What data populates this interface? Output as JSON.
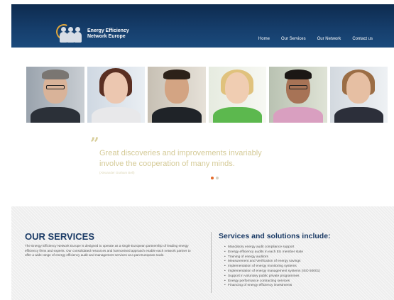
{
  "header": {
    "logo_line1": "Energy Efficiency",
    "logo_line2": "Network Europe",
    "nav": [
      "Home",
      "Our Services",
      "Our Network",
      "Contact us"
    ]
  },
  "slider": {
    "quote": "Great discoveries and improvements invariably involve the cooperation of many minds.",
    "author": "(Alexander Graham Bell)",
    "active_slide": 1,
    "total_slides": 2
  },
  "services": {
    "title": "OUR SERVICES",
    "body": "The Energy Efficiency Network Europe is designed to operate as a single European partnership of leading energy efficiency firms and experts. Our consolidated resources and harmonised approach enable each network partner to offer a wide range of energy efficiency audit and management services at a pan-European scale.",
    "solutions_title": "Services and solutions include:",
    "solutions": [
      "Mandatory energy audit compliance support",
      "Energy efficiency audits in each EU member state",
      "Training of energy auditors",
      "Measurement and Verification of energy savings",
      "Implementation of energy monitoring systems",
      "Implementation of energy management systems (ISO 50001)",
      "Support in voluntary public private programmes",
      "Energy performance contracting services",
      "Financing of energy efficiency investments"
    ]
  },
  "colors": {
    "header_bg": "#163f6d",
    "accent_orange": "#e56a2a",
    "heading_blue": "#1b3b66",
    "quote_tan": "#d5cb98"
  }
}
